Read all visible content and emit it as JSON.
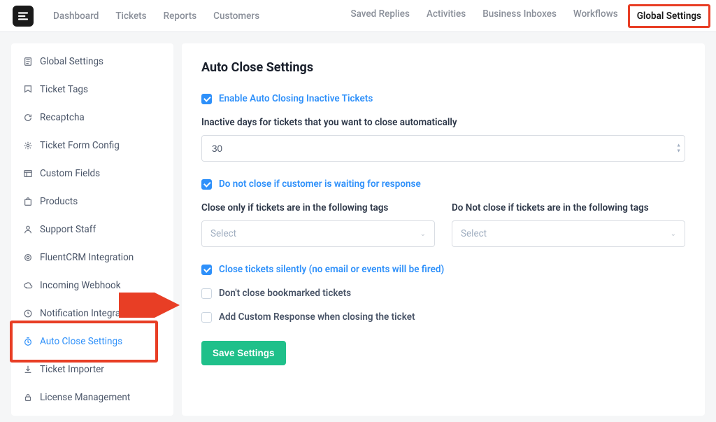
{
  "nav": {
    "left": [
      "Dashboard",
      "Tickets",
      "Reports",
      "Customers"
    ],
    "right": [
      "Saved Replies",
      "Activities",
      "Business Inboxes",
      "Workflows"
    ],
    "active_right": "Global Settings"
  },
  "sidebar": {
    "items": [
      {
        "label": "Global Settings",
        "icon": "settings-doc"
      },
      {
        "label": "Ticket Tags",
        "icon": "tag"
      },
      {
        "label": "Recaptcha",
        "icon": "refresh"
      },
      {
        "label": "Ticket Form Config",
        "icon": "gear"
      },
      {
        "label": "Custom Fields",
        "icon": "list"
      },
      {
        "label": "Products",
        "icon": "bag"
      },
      {
        "label": "Support Staff",
        "icon": "user"
      },
      {
        "label": "FluentCRM Integration",
        "icon": "circle"
      },
      {
        "label": "Incoming Webhook",
        "icon": "cloud"
      },
      {
        "label": "Notification Integrations",
        "icon": "bell"
      },
      {
        "label": "Auto Close Settings",
        "icon": "clock",
        "active": true
      },
      {
        "label": "Ticket Importer",
        "icon": "download"
      },
      {
        "label": "License Management",
        "icon": "lock"
      }
    ]
  },
  "main": {
    "title": "Auto Close Settings",
    "enable_label": "Enable Auto Closing Inactive Tickets",
    "inactive_days_label": "Inactive days for tickets that you want to close automatically",
    "inactive_days_value": "30",
    "do_not_close_waiting_label": "Do not close if customer is waiting for response",
    "close_only_tags_label": "Close only if tickets are in the following tags",
    "do_not_close_tags_label": "Do Not close if tickets are in the following tags",
    "select_placeholder": "Select",
    "close_silently_label": "Close tickets silently (no email or events will be fired)",
    "dont_close_bookmarked_label": "Don't close bookmarked tickets",
    "add_custom_response_label": "Add Custom Response when closing the ticket",
    "save_button": "Save Settings"
  }
}
